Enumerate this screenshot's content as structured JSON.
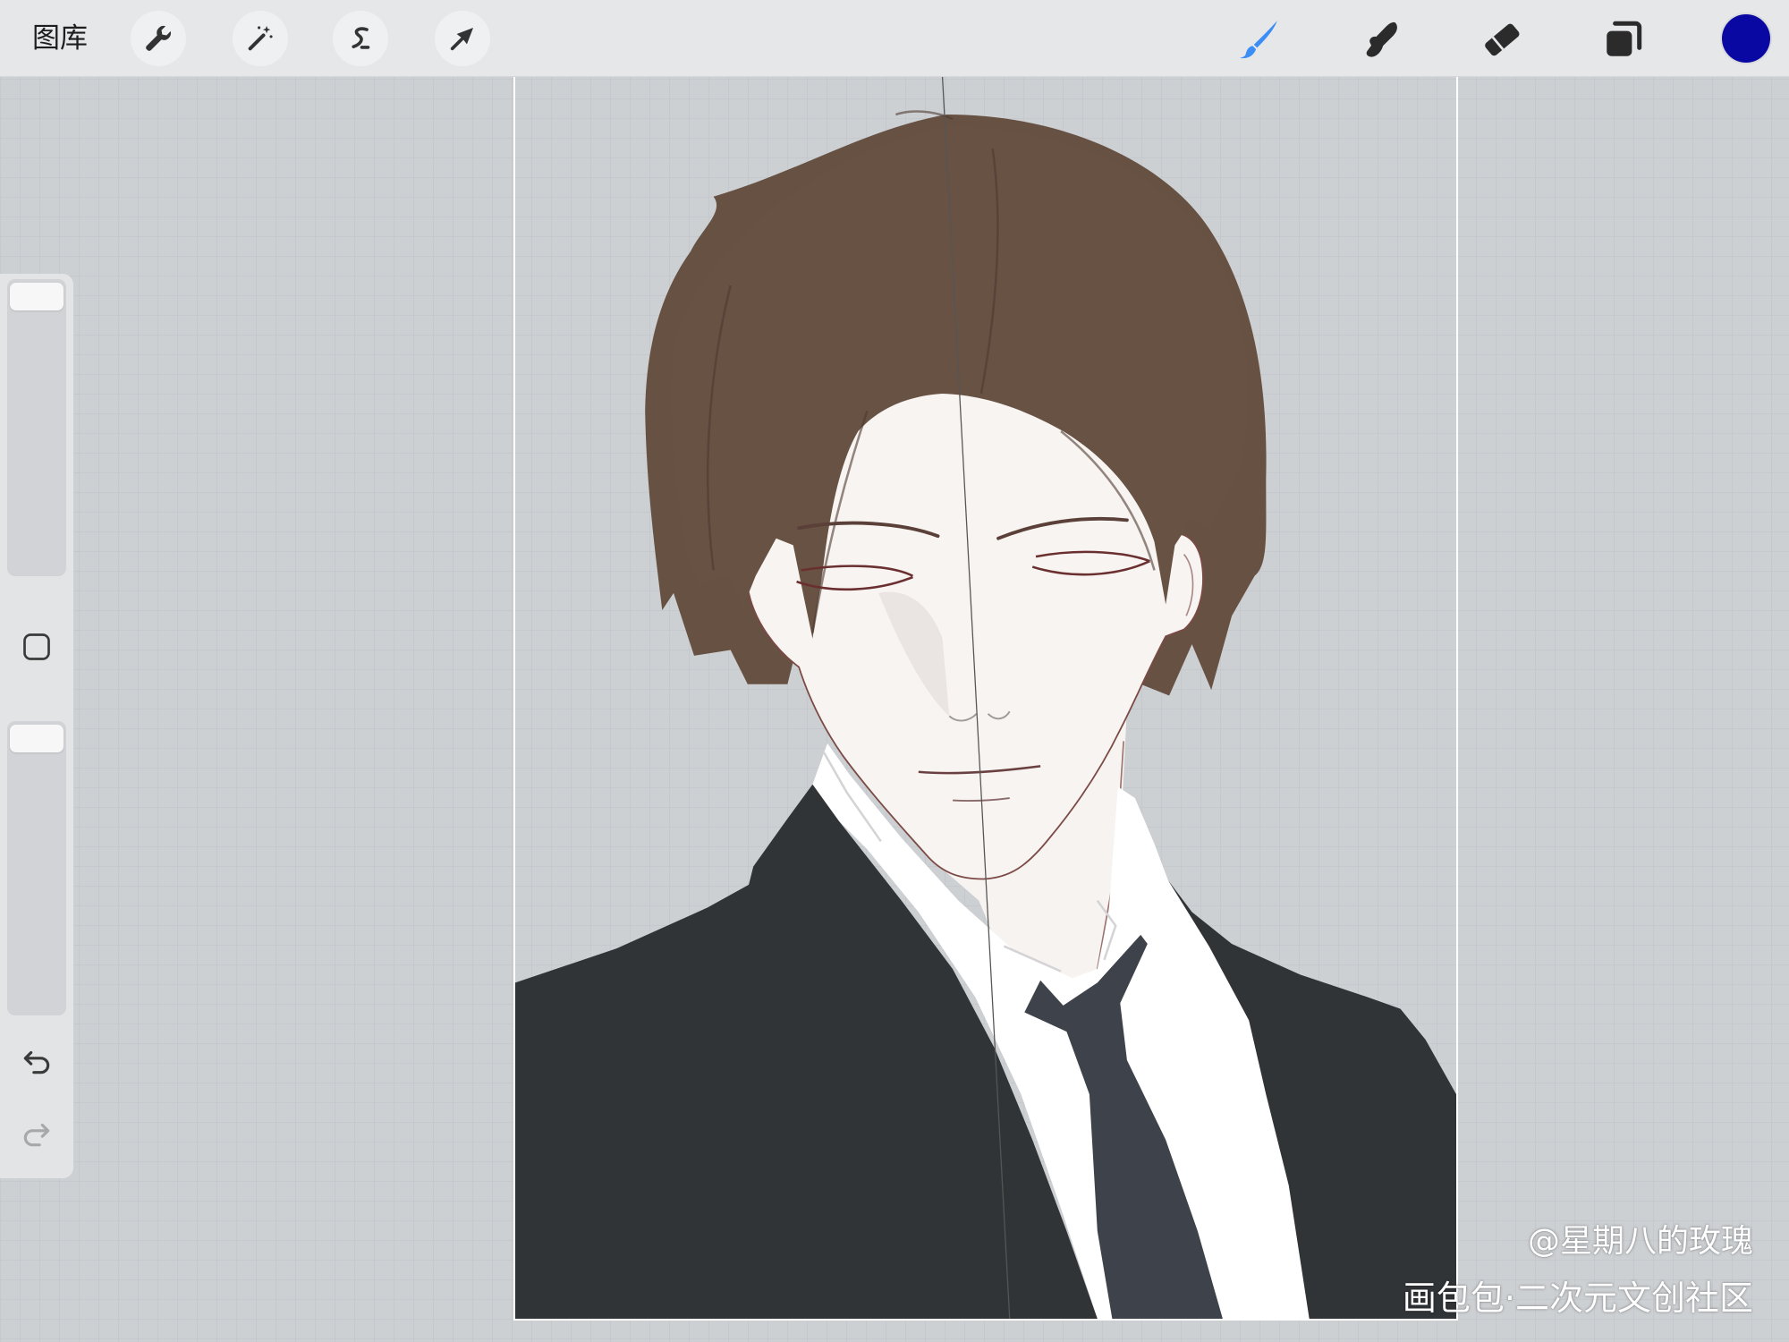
{
  "topbar": {
    "gallery_label": "图库",
    "left_tools": [
      "wrench-icon",
      "magic-wand-icon",
      "selection-icon",
      "transform-arrow-icon"
    ],
    "right_tools": [
      "brush-icon",
      "smudge-icon",
      "eraser-icon",
      "layers-icon"
    ],
    "active_tool": "brush-icon",
    "active_tool_color": "#3a8ef5",
    "current_color": "#0a08a3"
  },
  "sidebar": {
    "brush_size_level": 1.0,
    "opacity_level": 1.0,
    "icons": [
      "square-icon",
      "undo-icon",
      "redo-icon"
    ],
    "redo_enabled": false
  },
  "watermark": {
    "handle": "@星期八的玫瑰",
    "site": "画包包·二次元文创社区"
  },
  "colors": {
    "workspace_background": "#cdd0d3",
    "toolbar_background": "#e6e7e9",
    "tool_icon": "#333333"
  }
}
